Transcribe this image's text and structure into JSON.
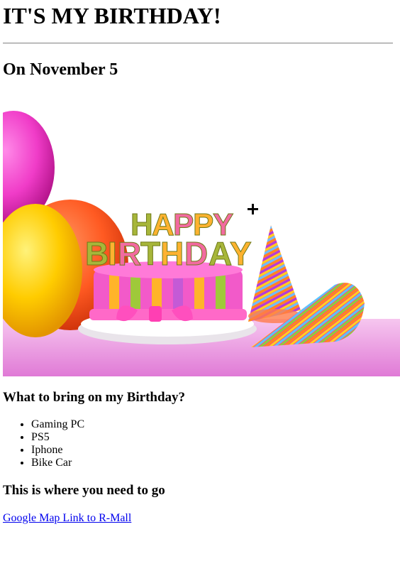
{
  "heading": "IT'S MY BIRTHDAY!",
  "subheading": "On November 5",
  "hero_image": {
    "description_icon": "birthday-cake-image",
    "cake_topper_text": "HAPPY BIRTHDAY",
    "colors": {
      "balloon_pink": "#f03cc8",
      "balloon_yellow": "#ffc800",
      "balloon_orange": "#ff6a2a",
      "tablecloth": "#e98ee0",
      "cake_pink": "#f25ac9"
    }
  },
  "bring_section": {
    "title": "What to bring on my Birthday?",
    "items": [
      "Gaming PC",
      "PS5",
      "Iphone",
      "Bike Car"
    ]
  },
  "location_section": {
    "title": "This is where you need to go",
    "link_text": "Google Map Link to R-Mall"
  }
}
